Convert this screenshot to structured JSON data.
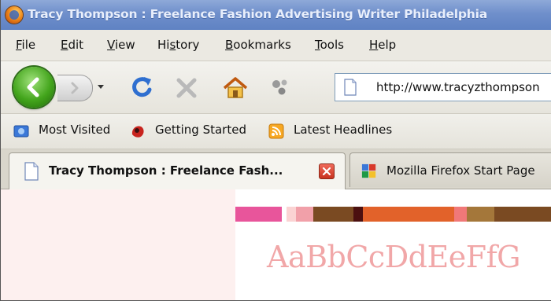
{
  "window": {
    "title": "Tracy Thompson : Freelance Fashion Advertising Writer Philadelphia"
  },
  "menubar": {
    "items": [
      {
        "label": "File",
        "mnemonic": "F"
      },
      {
        "label": "Edit",
        "mnemonic": "E"
      },
      {
        "label": "View",
        "mnemonic": "V"
      },
      {
        "label": "History",
        "mnemonic": "s"
      },
      {
        "label": "Bookmarks",
        "mnemonic": "B"
      },
      {
        "label": "Tools",
        "mnemonic": "T"
      },
      {
        "label": "Help",
        "mnemonic": "H"
      }
    ]
  },
  "navbar": {
    "back_icon": "back-arrow-icon",
    "forward_icon": "forward-arrow-icon",
    "reload_icon": "reload-icon",
    "stop_icon": "stop-icon",
    "home_icon": "home-icon",
    "addon_icon": "addon-icon",
    "url": "http://www.tracyzthompson"
  },
  "bookmarks": {
    "items": [
      {
        "label": "Most Visited",
        "icon": "most-visited-icon"
      },
      {
        "label": "Getting Started",
        "icon": "firefox-icon"
      },
      {
        "label": "Latest Headlines",
        "icon": "rss-feed-icon"
      }
    ]
  },
  "tabs": [
    {
      "title": "Tracy Thompson : Freelance Fash...",
      "active": true,
      "icon": "page-icon"
    },
    {
      "title": "Mozilla Firefox Start Page",
      "active": false,
      "icon": "google-icon"
    }
  ],
  "page": {
    "alphabet_text": "AaBbCcDdEeFfG",
    "colors": {
      "side_panel": "#fdf0ef",
      "alphabet": "#f1a7a8",
      "stripe": [
        "#e8559b",
        "#fbd3d3",
        "#f1a0a9",
        "#7a4a22",
        "#4b1010",
        "#e2622a",
        "#f07878",
        "#a4773a",
        "#7a4a22"
      ]
    }
  }
}
